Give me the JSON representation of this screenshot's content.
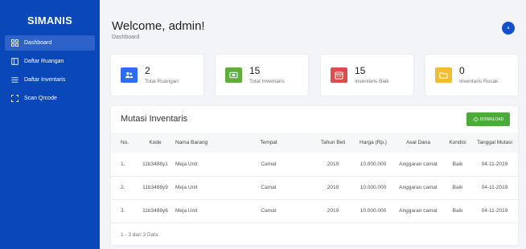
{
  "sidebar": {
    "brand": "SIMANIS",
    "items": [
      {
        "label": "Dashboard",
        "icon": "grid-icon"
      },
      {
        "label": "Daftar Ruangan",
        "icon": "room-icon"
      },
      {
        "label": "Daftar Inventaris",
        "icon": "list-icon"
      },
      {
        "label": "Scan Qrcode",
        "icon": "scan-icon"
      }
    ]
  },
  "header": {
    "title": "Welcome, admin!",
    "breadcrumb": "Dashboard",
    "avatar_initial": "a"
  },
  "stats": [
    {
      "value": "2",
      "label": "Total Ruangan",
      "icon": "users-icon",
      "color": "#2d6cf6"
    },
    {
      "value": "15",
      "label": "Total Inventaris",
      "icon": "inventory-icon",
      "color": "#5fae3a"
    },
    {
      "value": "15",
      "label": "Inventaris Baik",
      "icon": "calendar-icon",
      "color": "#e04a4a"
    },
    {
      "value": "0",
      "label": "Inventaris Rusak",
      "icon": "folder-icon",
      "color": "#f4bd2b"
    }
  ],
  "mutasi": {
    "title": "Mutasi Inventaris",
    "download_label": "DOWNLOAD",
    "columns": [
      "No.",
      "Kode",
      "Nama Barang",
      "Tempat",
      "Tahun Beli",
      "Harga (Rp.)",
      "Asal Dana",
      "Kondisi",
      "Tanggal Mutasi"
    ],
    "rows": [
      [
        "1.",
        "11b3488y1",
        "Meja Unit",
        "Camat",
        "2019",
        "10.000.000",
        "Anggaran camat",
        "Baik",
        "04-11-2019"
      ],
      [
        "2.",
        "11b3488y9",
        "Meja Unit",
        "Camat",
        "2019",
        "10.000.000",
        "Anggaran camat",
        "Baik",
        "04-11-2019"
      ],
      [
        "3.",
        "11b3488y6",
        "Meja Unit",
        "Camat",
        "2019",
        "10.000.000",
        "Anggaran camat",
        "Baik",
        "04-11-2019"
      ]
    ],
    "footer": "1 - 3 dari 3 Data"
  },
  "colors": {
    "sidebar": "#0a47b8",
    "sidebar_active": "#2f62c8",
    "download": "#4caa3b"
  }
}
